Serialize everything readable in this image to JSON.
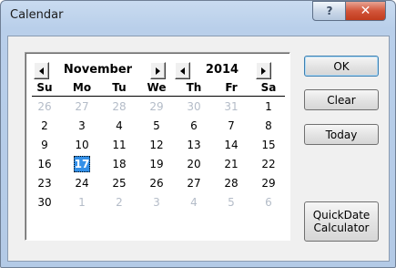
{
  "window": {
    "title": "Calendar"
  },
  "titlebar": {
    "help_glyph": "?",
    "close_glyph": "✕"
  },
  "calendar": {
    "month": "November",
    "year": "2014",
    "weekdays": [
      "Su",
      "Mo",
      "Tu",
      "We",
      "Th",
      "Fr",
      "Sa"
    ],
    "selected_day": "17",
    "weeks": [
      [
        {
          "d": "26",
          "m": true
        },
        {
          "d": "27",
          "m": true
        },
        {
          "d": "28",
          "m": true
        },
        {
          "d": "29",
          "m": true
        },
        {
          "d": "30",
          "m": true
        },
        {
          "d": "31",
          "m": true
        },
        {
          "d": "1",
          "m": false
        }
      ],
      [
        {
          "d": "2",
          "m": false
        },
        {
          "d": "3",
          "m": false
        },
        {
          "d": "4",
          "m": false
        },
        {
          "d": "5",
          "m": false
        },
        {
          "d": "6",
          "m": false
        },
        {
          "d": "7",
          "m": false
        },
        {
          "d": "8",
          "m": false
        }
      ],
      [
        {
          "d": "9",
          "m": false
        },
        {
          "d": "10",
          "m": false
        },
        {
          "d": "11",
          "m": false
        },
        {
          "d": "12",
          "m": false
        },
        {
          "d": "13",
          "m": false
        },
        {
          "d": "14",
          "m": false
        },
        {
          "d": "15",
          "m": false
        }
      ],
      [
        {
          "d": "16",
          "m": false
        },
        {
          "d": "17",
          "m": false
        },
        {
          "d": "18",
          "m": false
        },
        {
          "d": "19",
          "m": false
        },
        {
          "d": "20",
          "m": false
        },
        {
          "d": "21",
          "m": false
        },
        {
          "d": "22",
          "m": false
        }
      ],
      [
        {
          "d": "23",
          "m": false
        },
        {
          "d": "24",
          "m": false
        },
        {
          "d": "25",
          "m": false
        },
        {
          "d": "26",
          "m": false
        },
        {
          "d": "27",
          "m": false
        },
        {
          "d": "28",
          "m": false
        },
        {
          "d": "29",
          "m": false
        }
      ],
      [
        {
          "d": "30",
          "m": false
        },
        {
          "d": "1",
          "m": true
        },
        {
          "d": "2",
          "m": true
        },
        {
          "d": "3",
          "m": true
        },
        {
          "d": "4",
          "m": true
        },
        {
          "d": "5",
          "m": true
        },
        {
          "d": "6",
          "m": true
        }
      ]
    ]
  },
  "buttons": {
    "ok": "OK",
    "clear": "Clear",
    "today": "Today",
    "quickdate_line1": "QuickDate",
    "quickdate_line2": "Calculator"
  },
  "colors": {
    "selection": "#3390e8",
    "muted_day": "#b4bcc8",
    "close_button": "#c13b1d"
  }
}
